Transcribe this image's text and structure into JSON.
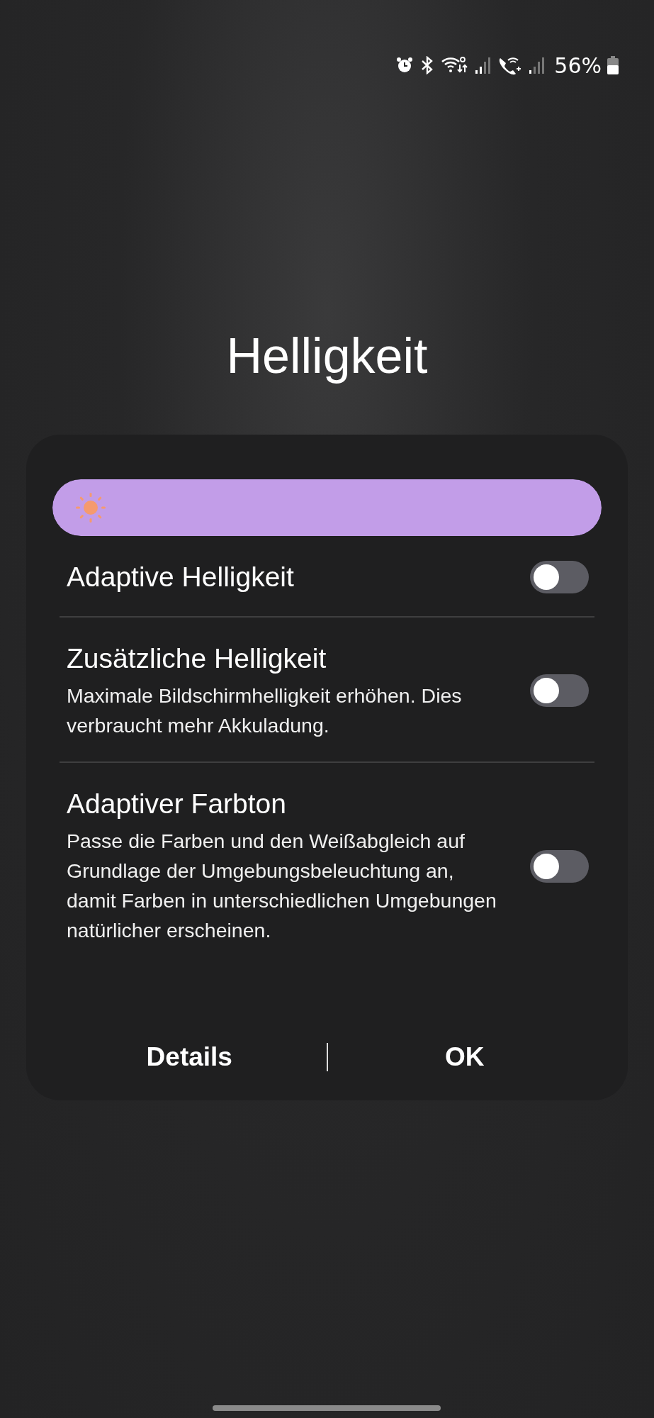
{
  "status_bar": {
    "battery": "56%"
  },
  "title": "Helligkeit",
  "brightness_slider": {
    "level": 1
  },
  "settings": [
    {
      "title": "Adaptive Helligkeit",
      "on": false
    },
    {
      "title": "Zusätzliche Helligkeit",
      "description": "Maximale Bildschirmhelligkeit erhöhen. Dies verbraucht mehr Akkuladung.",
      "on": false
    },
    {
      "title": "Adaptiver Farbton",
      "description": "Passe die Farben und den Weißabgleich auf Grundlage der Umgebungsbeleuchtung an, damit Farben in unterschiedlichen Umgebungen natürlicher erscheinen.",
      "on": false
    }
  ],
  "buttons": [
    "Details",
    "OK"
  ]
}
